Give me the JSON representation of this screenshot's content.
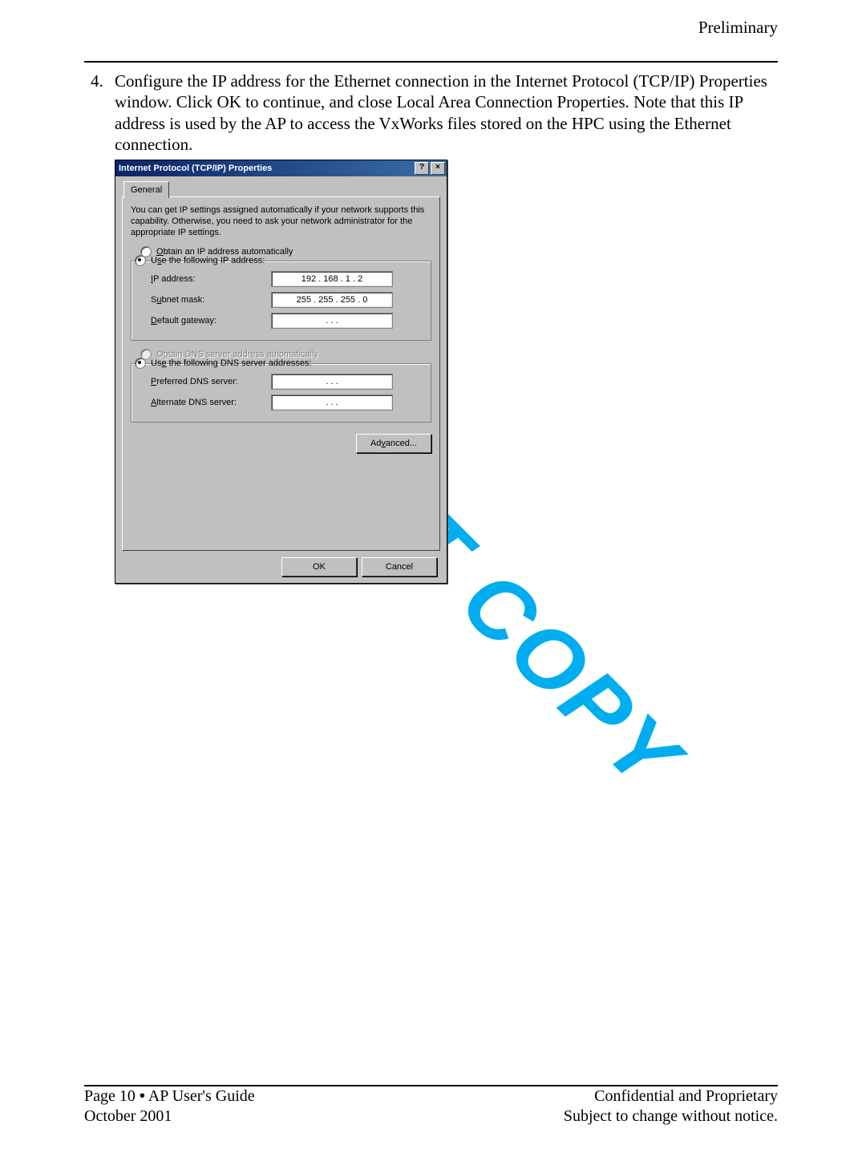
{
  "header": {
    "right": "Preliminary"
  },
  "step": {
    "num": "4.",
    "text": "Configure the IP address for the Ethernet connection in the Internet Protocol (TCP/IP) Properties window.  Click OK to continue, and close Local Area Connection Properties.  Note that this IP address is used by the AP to access the VxWorks files stored on the HPC using the Ethernet connection."
  },
  "watermark": "DO NOT COPY",
  "dialog": {
    "title": "Internet Protocol (TCP/IP) Properties",
    "help_btn": "?",
    "close_btn": "×",
    "tab": "General",
    "info": "You can get IP settings assigned automatically if your network supports this capability. Otherwise, you need to ask your network administrator for the appropriate IP settings.",
    "radios": {
      "auto_ip": "Obtain an IP address automatically",
      "use_ip": "Use the following IP address:",
      "auto_dns": "Obtain DNS server address automatically",
      "use_dns": "Use the following DNS server addresses:"
    },
    "fields": {
      "ip_label": "IP address:",
      "ip_value": "192 . 168 .   1   .   2",
      "subnet_label": "Subnet mask:",
      "subnet_value": "255 . 255 . 255 .   0",
      "gateway_label": "Default gateway:",
      "gateway_value": ".        .        .",
      "pref_dns_label": "Preferred DNS server:",
      "pref_dns_value": ".        .        .",
      "alt_dns_label": "Alternate DNS server:",
      "alt_dns_value": ".        .        ."
    },
    "buttons": {
      "advanced": "Advanced...",
      "ok": "OK",
      "cancel": "Cancel"
    }
  },
  "footer": {
    "left1_pre": "Page 10 ",
    "left1_post": "  AP User's Guide",
    "bullet": "•",
    "left2": "October 2001",
    "right1": "Confidential and Proprietary",
    "right2": "Subject to change without notice."
  }
}
